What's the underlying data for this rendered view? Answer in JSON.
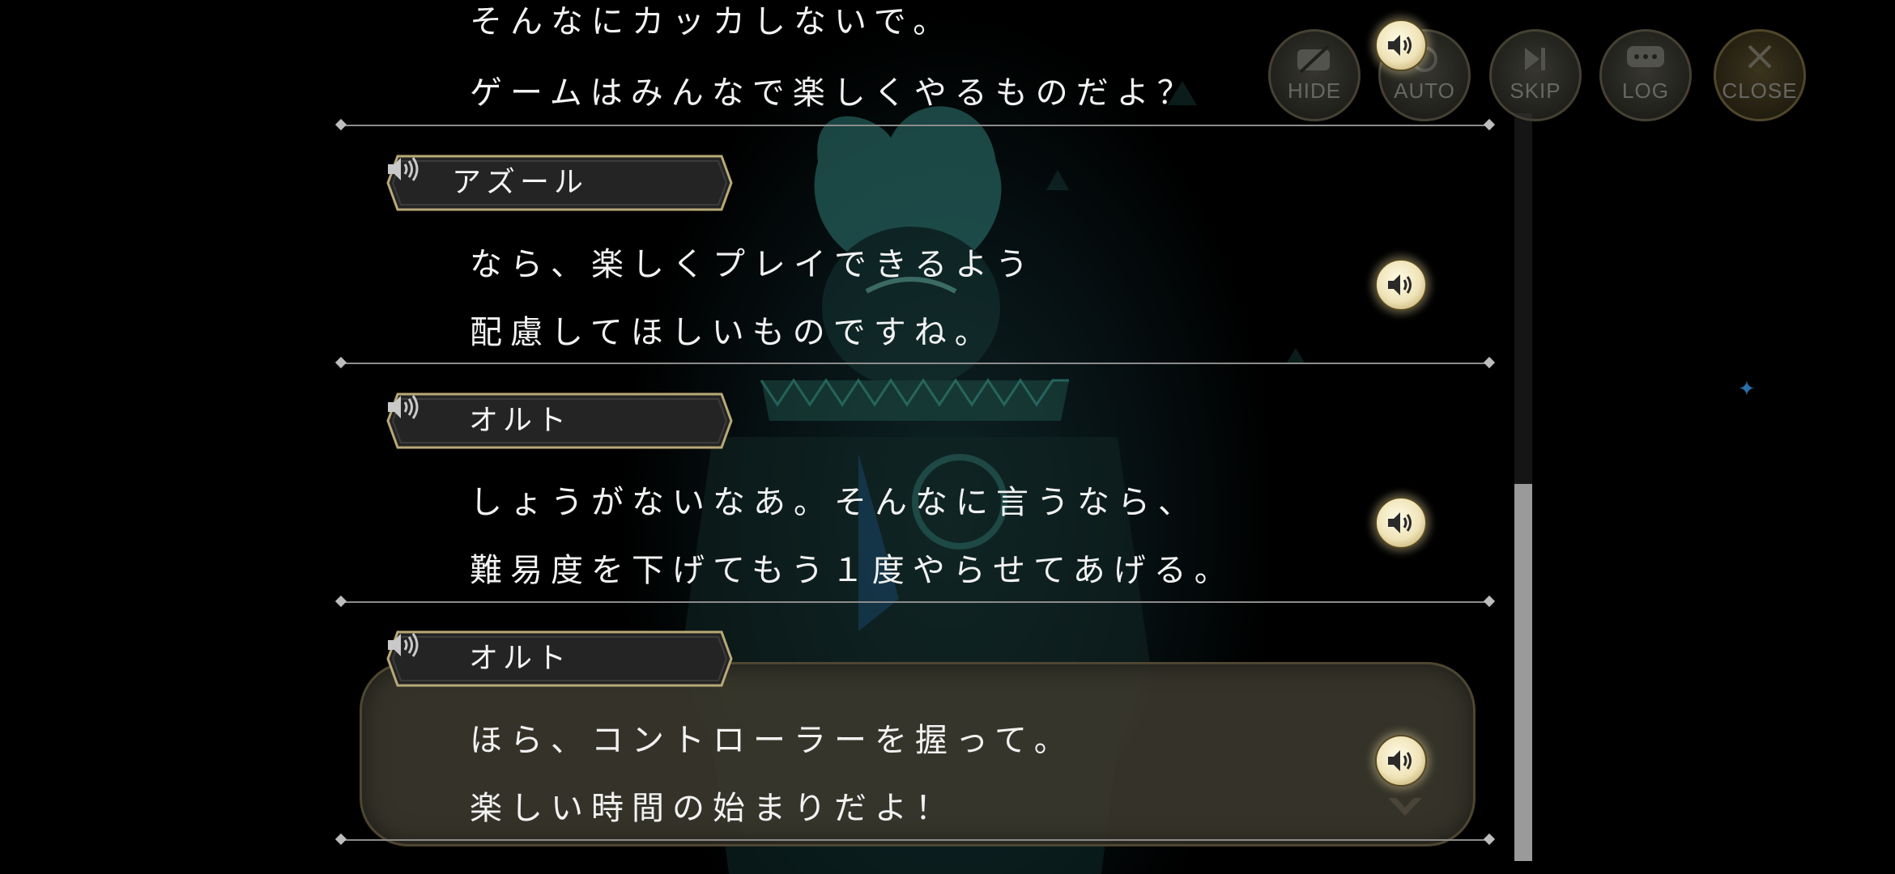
{
  "menu": {
    "hide_label": "HIDE",
    "auto_label": "AUTO",
    "skip_label": "SKIP",
    "log_label": "LOG",
    "close_label": "CLOSE"
  },
  "log": {
    "entries": [
      {
        "speaker": "",
        "lines": [
          "そんなにカッカしないで。",
          "ゲームはみんなで楽しくやるものだよ？"
        ]
      },
      {
        "speaker": "アズール",
        "lines": [
          "なら、楽しくプレイできるよう",
          "配慮してほしいものですね。"
        ]
      },
      {
        "speaker": "オルト",
        "lines": [
          "しょうがないなあ。そんなに言うなら、",
          "難易度を下げてもう１度やらせてあげる。"
        ]
      },
      {
        "speaker": "オルト",
        "lines": [
          "ほら、コントローラーを握って。",
          "楽しい時間の始まりだよ！"
        ]
      }
    ]
  },
  "icons": {
    "voice": "speaker-icon",
    "next": "chevron-down-icon"
  },
  "colors": {
    "text": "#f2f2f2",
    "voice_button": "#efe3b8",
    "scrollbar_thumb": "#9a9a9a",
    "current_box": "#3a372d"
  }
}
